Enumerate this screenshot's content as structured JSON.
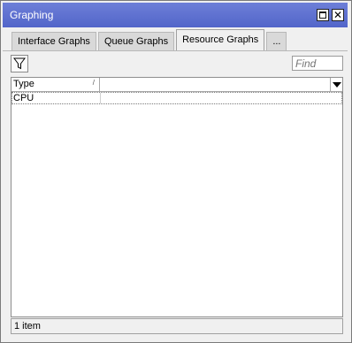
{
  "window": {
    "title": "Graphing",
    "title_bar_color": "#5b6fd1"
  },
  "tabs": [
    {
      "label": "Interface Graphs",
      "active": false
    },
    {
      "label": "Queue Graphs",
      "active": false
    },
    {
      "label": "Resource Graphs",
      "active": true
    },
    {
      "label": "...",
      "active": false
    }
  ],
  "toolbar": {
    "filter_icon": "filter-icon",
    "find_placeholder": "Find"
  },
  "table": {
    "columns": [
      {
        "header": "Type",
        "sort": "ascending"
      }
    ],
    "rows": [
      {
        "type": "CPU"
      }
    ]
  },
  "status": {
    "count_text": "1 item"
  }
}
